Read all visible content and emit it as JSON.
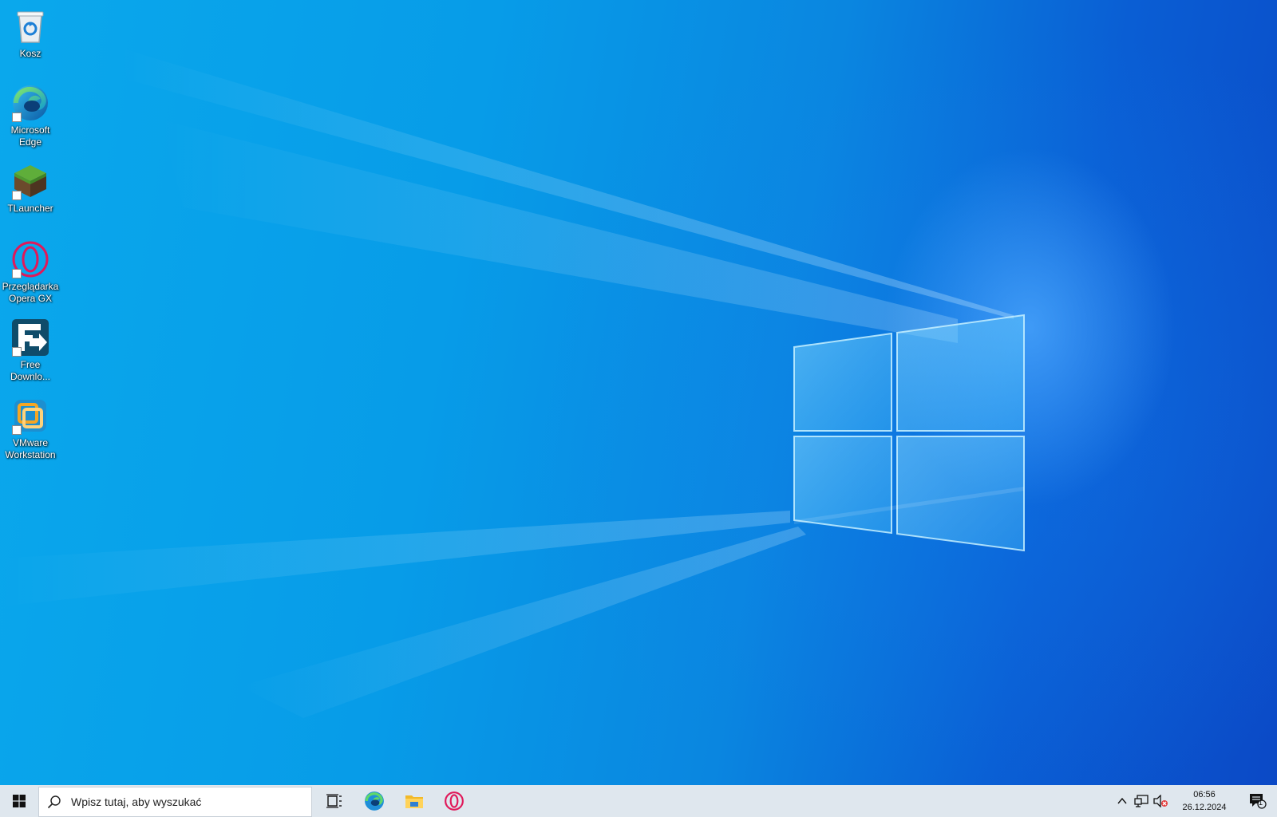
{
  "desktop": {
    "icons": [
      {
        "label": "Kosz",
        "icon": "recycle-bin-icon"
      },
      {
        "label": "Microsoft Edge",
        "icon": "edge-icon"
      },
      {
        "label": "TLauncher",
        "icon": "tlauncher-icon"
      },
      {
        "label": "Przeglądarka Opera GX",
        "icon": "opera-gx-icon"
      },
      {
        "label": "Free Downlo...",
        "icon": "free-download-manager-icon"
      },
      {
        "label": "VMware Workstation",
        "icon": "vmware-icon"
      }
    ]
  },
  "taskbar": {
    "search_placeholder": "Wpisz tutaj, aby wyszukać",
    "pinned": [
      "task-view-icon",
      "edge-icon",
      "file-explorer-icon",
      "opera-gx-icon"
    ],
    "clock": {
      "time": "06:56",
      "date": "26.12.2024"
    },
    "notification_count": "1"
  },
  "colors": {
    "accent": "#0a86e0",
    "taskbar_bg": "#dfe7ee"
  }
}
